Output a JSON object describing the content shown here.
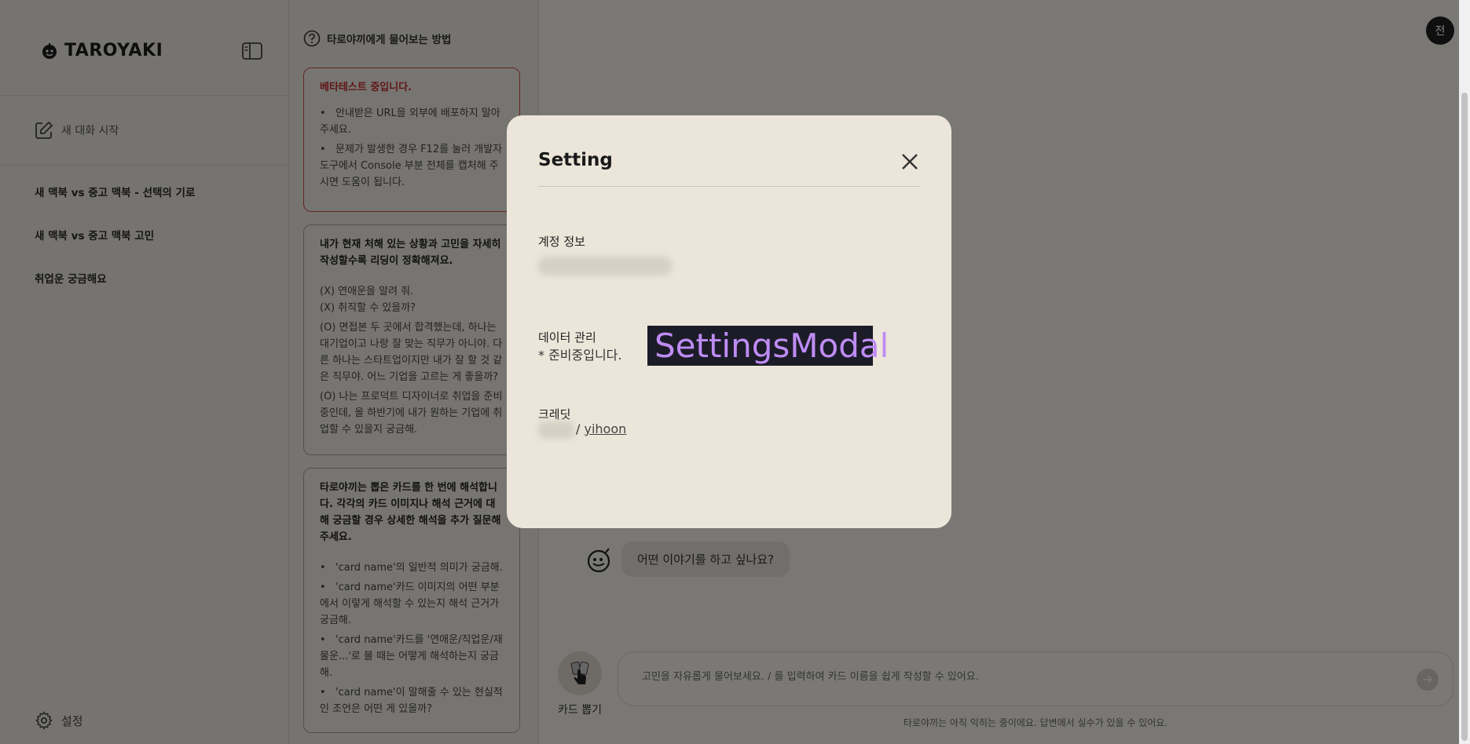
{
  "app": {
    "brand": "TAROYAKI"
  },
  "sidebar": {
    "new_chat_label": "새 대화 시작",
    "history": [
      {
        "label": "새 맥북 vs 중고 맥북 - 선택의 기로"
      },
      {
        "label": "새 맥북 vs 중고 맥북 고민"
      },
      {
        "label": "취업운 궁금해요"
      }
    ],
    "settings_label": "설정"
  },
  "guide": {
    "heading": "타로야끼에게 물어보는 방법",
    "beta": {
      "title": "베타테스트 중입니다.",
      "items": [
        "안내받은 URL을 외부에 배포하지 말아주세요.",
        "문제가 발생한 경우 F12를 눌러 개발자 도구에서 Console 부분 전체를 캡처해 주시면 도움이 됩니다."
      ]
    },
    "situation": {
      "title": "내가 현재 처해 있는 상황과 고민을 자세히 작성할수록 리딩이 정확해져요.",
      "examples": [
        "(X) 연애운을 알려 줘.",
        "(X) 취직할 수 있을까?",
        "(O) 면접본 두 곳에서 합격했는데, 하나는 대기업이고 나랑 잘 맞는 직무가 아니야. 다른 하나는 스타트업이지만 내가 잘 할 것 같은 직무야. 어느 기업을 고르는 게 좋을까?",
        "(O) 나는 프로덕트 디자이너로 취업을 준비중인데, 올 하반기에 내가 원하는 기업에 취업할 수 있을지 궁금해."
      ]
    },
    "cards": {
      "title": "타로야끼는 뽑은 카드를 한 번에 해석합니다. 각각의 카드 이미지나 해석 근거에 대해 궁금할 경우 상세한 해석을 추가 질문해주세요.",
      "items": [
        "'card name'의 일반적 의미가 궁금해.",
        "'card name'카드 이미지의 어떤 부분에서 이렇게 해석할 수 있는지 해석 근거가 궁금해.",
        "'card name'카드를 '연애운/직업운/재물운...'로 볼 때는 어떻게 해석하는지 궁금해.",
        "'card name'이 말해줄 수 있는 현실적인 조언은 어떤 게 있을까?"
      ]
    }
  },
  "main": {
    "avatar_initial": "전",
    "bot_message": "어떤 이야기를 하고 싶나요?",
    "draw_card_label": "카드 뽑기",
    "input_placeholder": "고민을 자유롭게 물어보세요. / 를 입력하여 카드 이름을 쉽게 작성할 수 있어요.",
    "disclaimer": "타로야끼는 아직 익히는 중이에요. 답변에서 실수가 있을 수 있어요."
  },
  "modal": {
    "title": "Setting",
    "account_label": "계정 정보",
    "data_label": "데이터 관리",
    "data_note": "* 준비중입니다.",
    "component_label": "SettingsModal",
    "credit_label": "크레딧",
    "credit_separator": "/",
    "credit_link": "yihoon"
  },
  "colors": {
    "overlay": "#000000",
    "warn": "#c02f2f",
    "modal_bg": "#ece6da",
    "component_label_text": "#bf8cf5"
  }
}
